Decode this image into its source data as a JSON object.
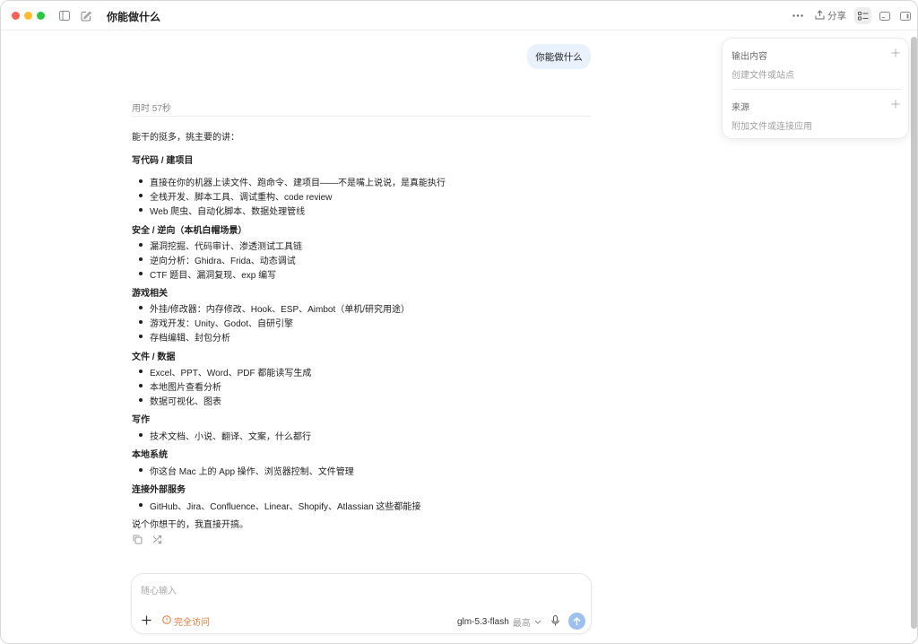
{
  "window": {
    "title": "你能做什么",
    "share_label": "分享"
  },
  "conversation": {
    "user_message": "你能做什么",
    "elapsed": "用时 57秒",
    "intro": "能干的挺多，挑主要的讲：",
    "sections": [
      {
        "heading": "写代码 / 建项目",
        "items": [
          "直接在你的机器上读文件、跑命令、建项目——不是嘴上说说，是真能执行",
          "全栈开发、脚本工具、调试重构、code review",
          "Web 爬虫、自动化脚本、数据处理管线"
        ]
      },
      {
        "heading": "安全 / 逆向（本机白帽场景）",
        "items": [
          "漏洞挖掘、代码审计、渗透测试工具链",
          "逆向分析：Ghidra、Frida、动态调试",
          "CTF 题目、漏洞复现、exp 编写"
        ]
      },
      {
        "heading": "游戏相关",
        "items": [
          "外挂/修改器：内存修改、Hook、ESP、Aimbot（单机/研究用途）",
          "游戏开发：Unity、Godot、自研引擎",
          "存档编辑、封包分析"
        ]
      },
      {
        "heading": "文件 / 数据",
        "items": [
          "Excel、PPT、Word、PDF 都能读写生成",
          "本地图片查看分析",
          "数据可视化、图表"
        ]
      },
      {
        "heading": "写作",
        "items": [
          "技术文档、小说、翻译、文案，什么都行"
        ]
      },
      {
        "heading": "本地系统",
        "items": [
          "你这台 Mac 上的 App 操作、浏览器控制、文件管理"
        ]
      },
      {
        "heading": "连接外部服务",
        "items": [
          "GitHub、Jira、Confluence、Linear、Shopify、Atlassian 这些都能接"
        ]
      }
    ],
    "outro": "说个你想干的，我直接开搞。"
  },
  "composer": {
    "placeholder": "随心输入",
    "value": "",
    "access_label": "完全访问",
    "model_name": "glm-5.3-flash",
    "model_level": "最高"
  },
  "side_panel": {
    "output": {
      "title": "输出内容",
      "subtitle": "创建文件或站点"
    },
    "sources": {
      "title": "来源",
      "subtitle": "附加文件或连接应用"
    }
  },
  "icons": {
    "titlebar": [
      "sidebar-toggle-icon",
      "new-chat-icon",
      "more-icon",
      "share-icon",
      "panel-list-icon",
      "terminal-icon",
      "right-sidebar-icon"
    ],
    "message_actions": [
      "copy-icon",
      "branch-icon"
    ]
  },
  "colors": {
    "accent_send": "#9ec0ef",
    "user_bubble": "#e8f1fc",
    "access_warning": "#e07b39"
  }
}
